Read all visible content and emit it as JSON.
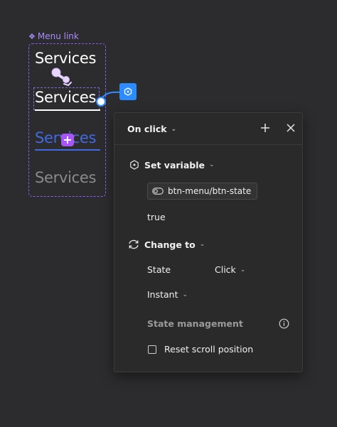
{
  "component": {
    "label": "Menu link",
    "variants": [
      "Services",
      "Services",
      "Services",
      "Services"
    ]
  },
  "panel": {
    "trigger": "On click",
    "actions": {
      "set_variable": {
        "title": "Set variable",
        "variable": "btn-menu/btn-state",
        "value": "true"
      },
      "change_to": {
        "title": "Change to",
        "state_label": "State",
        "state_value": "Click",
        "animation": "Instant"
      }
    },
    "state_management": {
      "title": "State management",
      "reset_scroll": "Reset scroll position"
    }
  },
  "colors": {
    "background": "#2c2c2e",
    "component_accent": "#8b5cf6",
    "link_blue": "#4169e1",
    "node_blue": "#2c8cff"
  },
  "icons": [
    "component-icon",
    "cursor-pointer-icon",
    "interaction-node-icon",
    "plus-icon",
    "close-icon",
    "variable-icon",
    "toggle-icon",
    "refresh-icon",
    "info-icon",
    "checkbox-icon"
  ]
}
